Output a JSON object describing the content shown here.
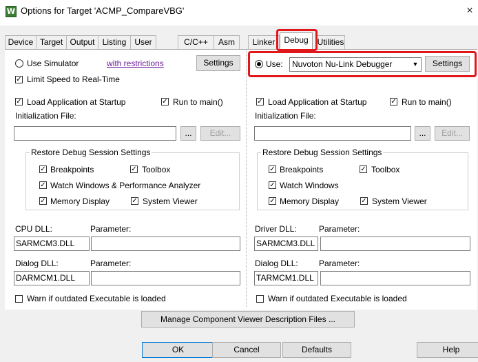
{
  "window": {
    "title": "Options for Target 'ACMP_CompareVBG'",
    "app_icon": "keil-uvision-icon",
    "close_glyph": "×"
  },
  "tabs": [
    {
      "label": "Device"
    },
    {
      "label": "Target"
    },
    {
      "label": "Output"
    },
    {
      "label": "Listing"
    },
    {
      "label": "User"
    },
    {
      "label": "C/C++"
    },
    {
      "label": "Asm"
    },
    {
      "label": "Linker"
    },
    {
      "label": "Debug"
    },
    {
      "label": "Utilities"
    }
  ],
  "active_tab": "Debug",
  "highlight_color": "#e0181b",
  "left": {
    "use_simulator": "Use Simulator",
    "restrictions_link": "with restrictions",
    "settings": "Settings",
    "limit_speed": "Limit Speed to Real-Time",
    "load_app": "Load Application at Startup",
    "run_to_main": "Run to main()",
    "init_file": "Initialization File:",
    "browse": "...",
    "edit": "Edit...",
    "restore_group": "Restore Debug Session Settings",
    "breakpoints": "Breakpoints",
    "toolbox": "Toolbox",
    "watch_windows": "Watch Windows & Performance Analyzer",
    "memory_display": "Memory Display",
    "system_viewer": "System Viewer",
    "dll_label": "CPU DLL:",
    "dll_param_label": "Parameter:",
    "dll_value": "SARMCM3.DLL",
    "dialog_dll_label": "Dialog DLL:",
    "dialog_param_label": "Parameter:",
    "dialog_dll_value": "DARMCM1.DLL",
    "warn": "Warn if outdated Executable is loaded"
  },
  "right": {
    "use": "Use:",
    "debugger": "Nuvoton Nu-Link Debugger",
    "settings": "Settings",
    "load_app": "Load Application at Startup",
    "run_to_main": "Run to main()",
    "init_file": "Initialization File:",
    "browse": "...",
    "edit": "Edit...",
    "restore_group": "Restore Debug Session Settings",
    "breakpoints": "Breakpoints",
    "toolbox": "Toolbox",
    "watch_windows": "Watch Windows",
    "memory_display": "Memory Display",
    "system_viewer": "System Viewer",
    "dll_label": "Driver DLL:",
    "dll_param_label": "Parameter:",
    "dll_value": "SARMCM3.DLL",
    "dialog_dll_label": "Dialog DLL:",
    "dialog_param_label": "Parameter:",
    "dialog_dll_value": "TARMCM1.DLL",
    "warn": "Warn if outdated Executable is loaded"
  },
  "manage_button": "Manage Component Viewer Description Files ...",
  "footer": {
    "ok": "OK",
    "cancel": "Cancel",
    "defaults": "Defaults",
    "help": "Help"
  },
  "check_glyph": "✓"
}
